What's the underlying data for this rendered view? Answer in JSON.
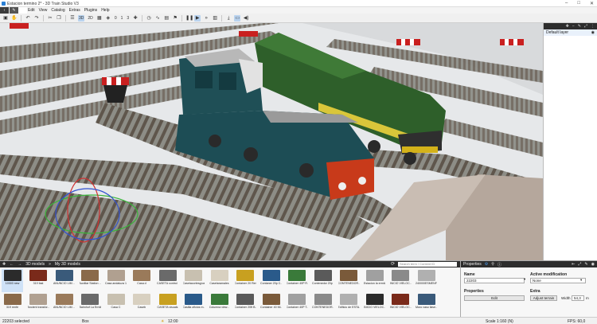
{
  "window": {
    "title": "Estacion termino 2* - 3D Train Studio V3",
    "min": "–",
    "max": "□",
    "close": "✕"
  },
  "menu": [
    "Edit",
    "View",
    "Catalog",
    "Extras",
    "Plugins",
    "Help"
  ],
  "toolbar": {
    "view_3d": "3D",
    "view_2d": "2D",
    "num1": "0",
    "num2": "1",
    "num3": "3"
  },
  "right_panel": {
    "layer_name": "Default layer"
  },
  "library": {
    "breadcrumb_root": "3D models",
    "breadcrumb_sep": "»",
    "breadcrumb_current": "My 3D models",
    "search_placeholder": "Search term / Content ID",
    "row1": [
      "10303 new",
      "319 fast",
      "ANUNCIO LIM ...",
      "Auxiliar Station ...",
      "Casa andaluza 1",
      "Casa d",
      "CASETA control ...",
      "Casetacortesgrueso",
      "Casetaramales",
      "Container 20 Renfe",
      "Contaner 20p C...",
      "Container 40P R...",
      "Contenedor 20p ...",
      "CONTENEDOR...",
      "Estacion la ermita",
      "INICIO VIELOC...",
      "240000ESMENF..."
    ],
    "row2": [
      "319 renfe",
      "Ancient transfor...",
      "ANUNCIO LIM ...",
      "Bahnhof La Ermita",
      "Casa C",
      "Caseb",
      "CASETA visuals",
      "Casilla oficios m...",
      "Columna view...",
      "Container 20ft B...",
      "Container 40 Mi...",
      "Container 40P T...",
      "CONTENEDOR...",
      "Edificio de ESTA...",
      "INICIO VIELOC...",
      "INICIO VIELOC...",
      "Muro vaso llave..."
    ]
  },
  "properties": {
    "title": "Properties",
    "name_label": "Name",
    "name_value": "22203",
    "active_mod_label": "Active modification",
    "active_mod_value": "None",
    "properties_label": "Properties",
    "edit_button": "Edit",
    "extra_label": "Extra",
    "adjust_terrain": "Adjust terrain",
    "width_label": "Width",
    "width_value": "54,3",
    "width_unit": "m"
  },
  "status": {
    "selected": "22203 selected",
    "mode": "Box",
    "time": "12:00",
    "scale": "Scale 1:160 (N)",
    "fps": "FPS: 60,0"
  },
  "colors": {
    "accent": "#2a7fd4",
    "panel_dark": "#2d2d2d"
  }
}
